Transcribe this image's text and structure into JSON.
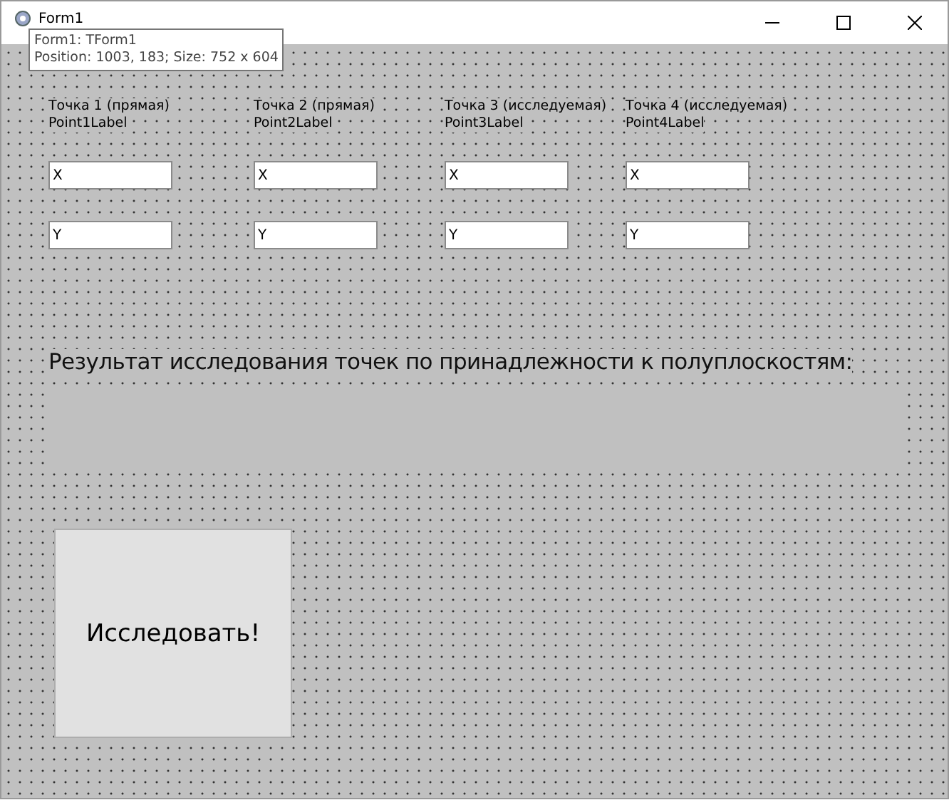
{
  "window": {
    "title": "Form1"
  },
  "tooltip": {
    "lines": [
      "Form1: TForm1",
      "Position: 1003, 183; Size: 752 x 604"
    ]
  },
  "points": [
    {
      "caption": "Точка 1 (прямая)",
      "name": "Point1Label",
      "x": "X",
      "y": "Y"
    },
    {
      "caption": "Точка 2 (прямая)",
      "name": "Point2Label",
      "x": "X",
      "y": "Y"
    },
    {
      "caption": "Точка 3 (исследуемая)",
      "name": "Point3Label",
      "x": "X",
      "y": "Y"
    },
    {
      "caption": "Точка 4 (исследуемая)",
      "name": "Point4Label",
      "x": "X",
      "y": "Y"
    }
  ],
  "result": {
    "label": "Результат исследования  точек по принадлежности к полуплоскостям:"
  },
  "buttons": [
    "Исследовать!"
  ]
}
